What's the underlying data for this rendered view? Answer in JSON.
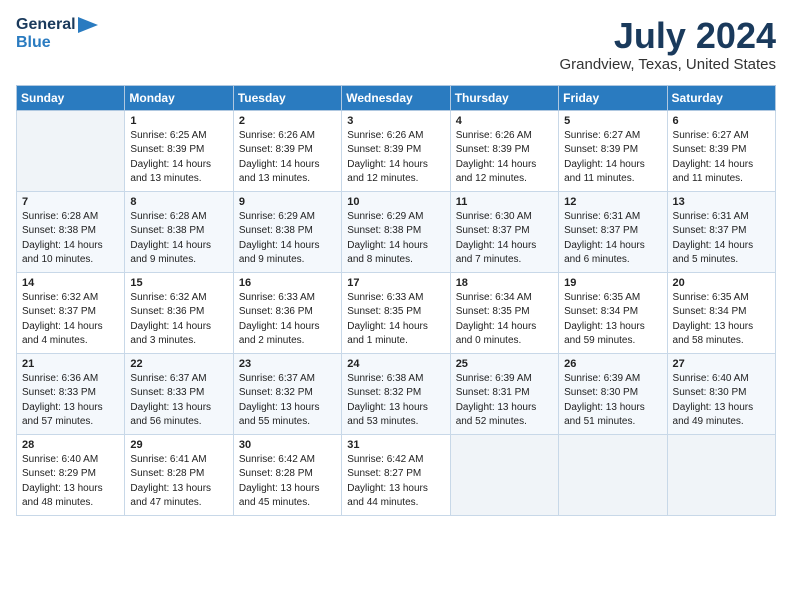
{
  "header": {
    "logo_line1": "General",
    "logo_line2": "Blue",
    "month_year": "July 2024",
    "location": "Grandview, Texas, United States"
  },
  "days_of_week": [
    "Sunday",
    "Monday",
    "Tuesday",
    "Wednesday",
    "Thursday",
    "Friday",
    "Saturday"
  ],
  "weeks": [
    [
      {
        "day": "",
        "sunrise": "",
        "sunset": "",
        "daylight": ""
      },
      {
        "day": "1",
        "sunrise": "Sunrise: 6:25 AM",
        "sunset": "Sunset: 8:39 PM",
        "daylight": "Daylight: 14 hours and 13 minutes."
      },
      {
        "day": "2",
        "sunrise": "Sunrise: 6:26 AM",
        "sunset": "Sunset: 8:39 PM",
        "daylight": "Daylight: 14 hours and 13 minutes."
      },
      {
        "day": "3",
        "sunrise": "Sunrise: 6:26 AM",
        "sunset": "Sunset: 8:39 PM",
        "daylight": "Daylight: 14 hours and 12 minutes."
      },
      {
        "day": "4",
        "sunrise": "Sunrise: 6:26 AM",
        "sunset": "Sunset: 8:39 PM",
        "daylight": "Daylight: 14 hours and 12 minutes."
      },
      {
        "day": "5",
        "sunrise": "Sunrise: 6:27 AM",
        "sunset": "Sunset: 8:39 PM",
        "daylight": "Daylight: 14 hours and 11 minutes."
      },
      {
        "day": "6",
        "sunrise": "Sunrise: 6:27 AM",
        "sunset": "Sunset: 8:39 PM",
        "daylight": "Daylight: 14 hours and 11 minutes."
      }
    ],
    [
      {
        "day": "7",
        "sunrise": "Sunrise: 6:28 AM",
        "sunset": "Sunset: 8:38 PM",
        "daylight": "Daylight: 14 hours and 10 minutes."
      },
      {
        "day": "8",
        "sunrise": "Sunrise: 6:28 AM",
        "sunset": "Sunset: 8:38 PM",
        "daylight": "Daylight: 14 hours and 9 minutes."
      },
      {
        "day": "9",
        "sunrise": "Sunrise: 6:29 AM",
        "sunset": "Sunset: 8:38 PM",
        "daylight": "Daylight: 14 hours and 9 minutes."
      },
      {
        "day": "10",
        "sunrise": "Sunrise: 6:29 AM",
        "sunset": "Sunset: 8:38 PM",
        "daylight": "Daylight: 14 hours and 8 minutes."
      },
      {
        "day": "11",
        "sunrise": "Sunrise: 6:30 AM",
        "sunset": "Sunset: 8:37 PM",
        "daylight": "Daylight: 14 hours and 7 minutes."
      },
      {
        "day": "12",
        "sunrise": "Sunrise: 6:31 AM",
        "sunset": "Sunset: 8:37 PM",
        "daylight": "Daylight: 14 hours and 6 minutes."
      },
      {
        "day": "13",
        "sunrise": "Sunrise: 6:31 AM",
        "sunset": "Sunset: 8:37 PM",
        "daylight": "Daylight: 14 hours and 5 minutes."
      }
    ],
    [
      {
        "day": "14",
        "sunrise": "Sunrise: 6:32 AM",
        "sunset": "Sunset: 8:37 PM",
        "daylight": "Daylight: 14 hours and 4 minutes."
      },
      {
        "day": "15",
        "sunrise": "Sunrise: 6:32 AM",
        "sunset": "Sunset: 8:36 PM",
        "daylight": "Daylight: 14 hours and 3 minutes."
      },
      {
        "day": "16",
        "sunrise": "Sunrise: 6:33 AM",
        "sunset": "Sunset: 8:36 PM",
        "daylight": "Daylight: 14 hours and 2 minutes."
      },
      {
        "day": "17",
        "sunrise": "Sunrise: 6:33 AM",
        "sunset": "Sunset: 8:35 PM",
        "daylight": "Daylight: 14 hours and 1 minute."
      },
      {
        "day": "18",
        "sunrise": "Sunrise: 6:34 AM",
        "sunset": "Sunset: 8:35 PM",
        "daylight": "Daylight: 14 hours and 0 minutes."
      },
      {
        "day": "19",
        "sunrise": "Sunrise: 6:35 AM",
        "sunset": "Sunset: 8:34 PM",
        "daylight": "Daylight: 13 hours and 59 minutes."
      },
      {
        "day": "20",
        "sunrise": "Sunrise: 6:35 AM",
        "sunset": "Sunset: 8:34 PM",
        "daylight": "Daylight: 13 hours and 58 minutes."
      }
    ],
    [
      {
        "day": "21",
        "sunrise": "Sunrise: 6:36 AM",
        "sunset": "Sunset: 8:33 PM",
        "daylight": "Daylight: 13 hours and 57 minutes."
      },
      {
        "day": "22",
        "sunrise": "Sunrise: 6:37 AM",
        "sunset": "Sunset: 8:33 PM",
        "daylight": "Daylight: 13 hours and 56 minutes."
      },
      {
        "day": "23",
        "sunrise": "Sunrise: 6:37 AM",
        "sunset": "Sunset: 8:32 PM",
        "daylight": "Daylight: 13 hours and 55 minutes."
      },
      {
        "day": "24",
        "sunrise": "Sunrise: 6:38 AM",
        "sunset": "Sunset: 8:32 PM",
        "daylight": "Daylight: 13 hours and 53 minutes."
      },
      {
        "day": "25",
        "sunrise": "Sunrise: 6:39 AM",
        "sunset": "Sunset: 8:31 PM",
        "daylight": "Daylight: 13 hours and 52 minutes."
      },
      {
        "day": "26",
        "sunrise": "Sunrise: 6:39 AM",
        "sunset": "Sunset: 8:30 PM",
        "daylight": "Daylight: 13 hours and 51 minutes."
      },
      {
        "day": "27",
        "sunrise": "Sunrise: 6:40 AM",
        "sunset": "Sunset: 8:30 PM",
        "daylight": "Daylight: 13 hours and 49 minutes."
      }
    ],
    [
      {
        "day": "28",
        "sunrise": "Sunrise: 6:40 AM",
        "sunset": "Sunset: 8:29 PM",
        "daylight": "Daylight: 13 hours and 48 minutes."
      },
      {
        "day": "29",
        "sunrise": "Sunrise: 6:41 AM",
        "sunset": "Sunset: 8:28 PM",
        "daylight": "Daylight: 13 hours and 47 minutes."
      },
      {
        "day": "30",
        "sunrise": "Sunrise: 6:42 AM",
        "sunset": "Sunset: 8:28 PM",
        "daylight": "Daylight: 13 hours and 45 minutes."
      },
      {
        "day": "31",
        "sunrise": "Sunrise: 6:42 AM",
        "sunset": "Sunset: 8:27 PM",
        "daylight": "Daylight: 13 hours and 44 minutes."
      },
      {
        "day": "",
        "sunrise": "",
        "sunset": "",
        "daylight": ""
      },
      {
        "day": "",
        "sunrise": "",
        "sunset": "",
        "daylight": ""
      },
      {
        "day": "",
        "sunrise": "",
        "sunset": "",
        "daylight": ""
      }
    ]
  ]
}
